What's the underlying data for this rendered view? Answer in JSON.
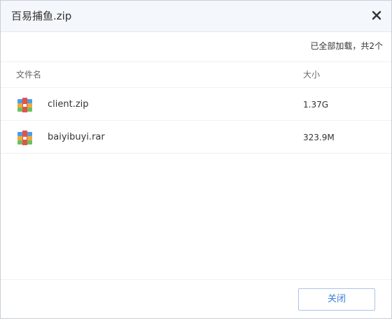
{
  "dialog": {
    "title": "百易捕鱼.zip",
    "status": "已全部加载，共2个"
  },
  "table": {
    "headers": {
      "name": "文件名",
      "size": "大小"
    },
    "rows": [
      {
        "name": "client.zip",
        "size": "1.37G",
        "icon": "archive-icon"
      },
      {
        "name": "baiyibuyi.rar",
        "size": "323.9M",
        "icon": "archive-icon"
      }
    ]
  },
  "footer": {
    "close_label": "关闭"
  },
  "colors": {
    "accent": "#3b7ed6",
    "title_bar": "#f4f7fb"
  }
}
